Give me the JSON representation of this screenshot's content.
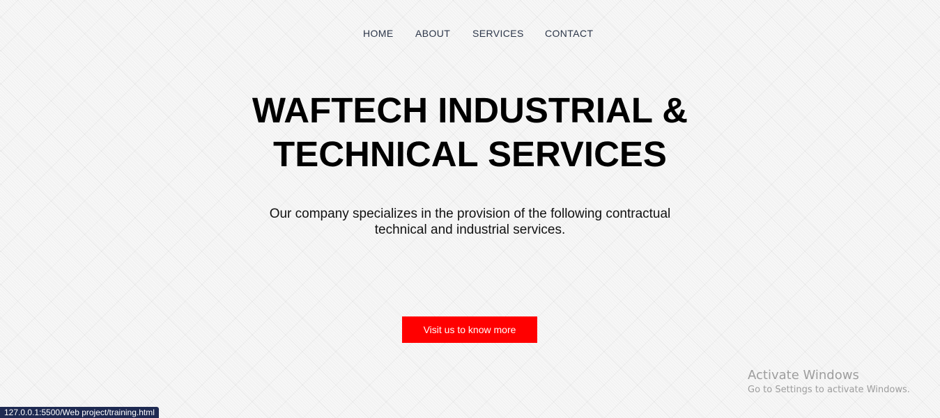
{
  "nav": {
    "items": [
      {
        "label": "HOME"
      },
      {
        "label": "ABOUT"
      },
      {
        "label": "SERVICES"
      },
      {
        "label": "CONTACT"
      }
    ]
  },
  "hero": {
    "title_line1": "WAFTECH INDUSTRIAL &",
    "title_line2": "TECHNICAL SERVICES",
    "subtitle_line1": "Our company specializes in the provision of the following contractual",
    "subtitle_line2": "technical and industrial services.",
    "cta_label": "Visit us to know more"
  },
  "colors": {
    "accent": "#ff0000",
    "nav_text": "#2b3548",
    "background": "#f2f2f2",
    "statusbar": "#1e2a52"
  },
  "watermark": {
    "title": "Activate Windows",
    "subtitle": "Go to Settings to activate Windows."
  },
  "statusbar": {
    "url": "127.0.0.1:5500/Web project/training.html"
  }
}
